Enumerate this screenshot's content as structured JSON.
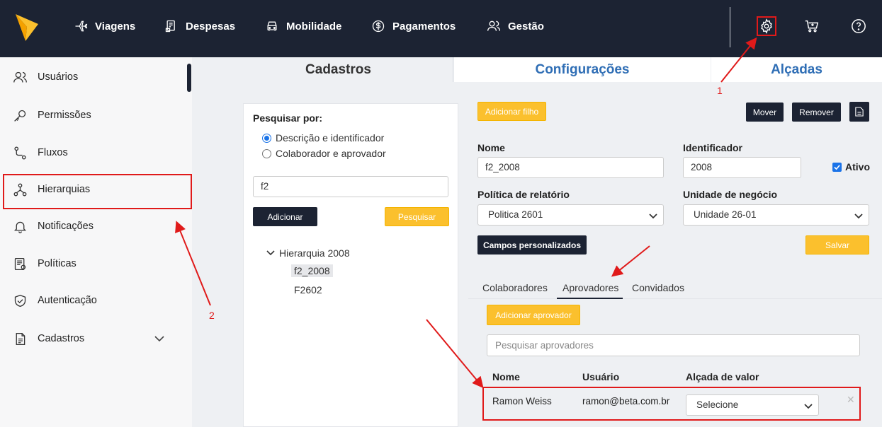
{
  "topnav": {
    "items": [
      {
        "label": "Viagens",
        "icon": "plane-icon"
      },
      {
        "label": "Despesas",
        "icon": "receipt-icon"
      },
      {
        "label": "Mobilidade",
        "icon": "car-icon"
      },
      {
        "label": "Pagamentos",
        "icon": "dollar-icon"
      },
      {
        "label": "Gestão",
        "icon": "users-icon"
      }
    ],
    "right_icons": [
      "gear-icon",
      "cart-icon",
      "help-icon"
    ]
  },
  "sidebar": {
    "items": [
      {
        "label": "Usuários",
        "icon": "users-icon"
      },
      {
        "label": "Permissões",
        "icon": "key-icon"
      },
      {
        "label": "Fluxos",
        "icon": "flow-icon"
      },
      {
        "label": "Hierarquias",
        "icon": "hierarchy-icon",
        "active": true
      },
      {
        "label": "Notificações",
        "icon": "bell-icon"
      },
      {
        "label": "Políticas",
        "icon": "policy-icon"
      },
      {
        "label": "Autenticação",
        "icon": "shield-icon"
      },
      {
        "label": "Cadastros",
        "icon": "document-icon",
        "expandable": true
      }
    ]
  },
  "main_tabs": [
    {
      "label": "Cadastros",
      "active": true
    },
    {
      "label": "Configurações"
    },
    {
      "label": "Alçadas"
    }
  ],
  "search_panel": {
    "title": "Pesquisar por:",
    "options": [
      {
        "label": "Descrição e identificador",
        "checked": true
      },
      {
        "label": "Colaborador e aprovador",
        "checked": false
      }
    ],
    "query": "f2",
    "add_label": "Adicionar",
    "search_label": "Pesquisar",
    "tree": {
      "root": "Hierarquia 2008",
      "children": [
        {
          "label": "f2_2008",
          "selected": true
        },
        {
          "label": "F2602",
          "selected": false
        }
      ]
    }
  },
  "form": {
    "add_child_label": "Adicionar filho",
    "move_label": "Mover",
    "remove_label": "Remover",
    "nome_label": "Nome",
    "nome_value": "f2_2008",
    "identificador_label": "Identificador",
    "identificador_value": "2008",
    "ativo_label": "Ativo",
    "ativo_checked": true,
    "politica_label": "Política de relatório",
    "politica_value": "Politica 2601",
    "unidade_label": "Unidade de negócio",
    "unidade_value": "Unidade 26-01",
    "custom_fields_label": "Campos personalizados",
    "save_label": "Salvar"
  },
  "sub_tabs": [
    {
      "label": "Colaboradores"
    },
    {
      "label": "Aprovadores",
      "active": true
    },
    {
      "label": "Convidados"
    }
  ],
  "approvers": {
    "add_label": "Adicionar aprovador",
    "search_placeholder": "Pesquisar aprovadores",
    "columns": [
      "Nome",
      "Usuário",
      "Alçada de valor"
    ],
    "rows": [
      {
        "nome": "Ramon Weiss",
        "usuario": "ramon@beta.com.br",
        "alcada": "Selecione"
      }
    ]
  },
  "annotations": {
    "step1": "1",
    "step2": "2"
  },
  "colors": {
    "topbar": "#1c2333",
    "accent_yellow": "#fbc02d",
    "link_blue": "#2f6eb5",
    "highlight_red": "#e01a1a"
  }
}
